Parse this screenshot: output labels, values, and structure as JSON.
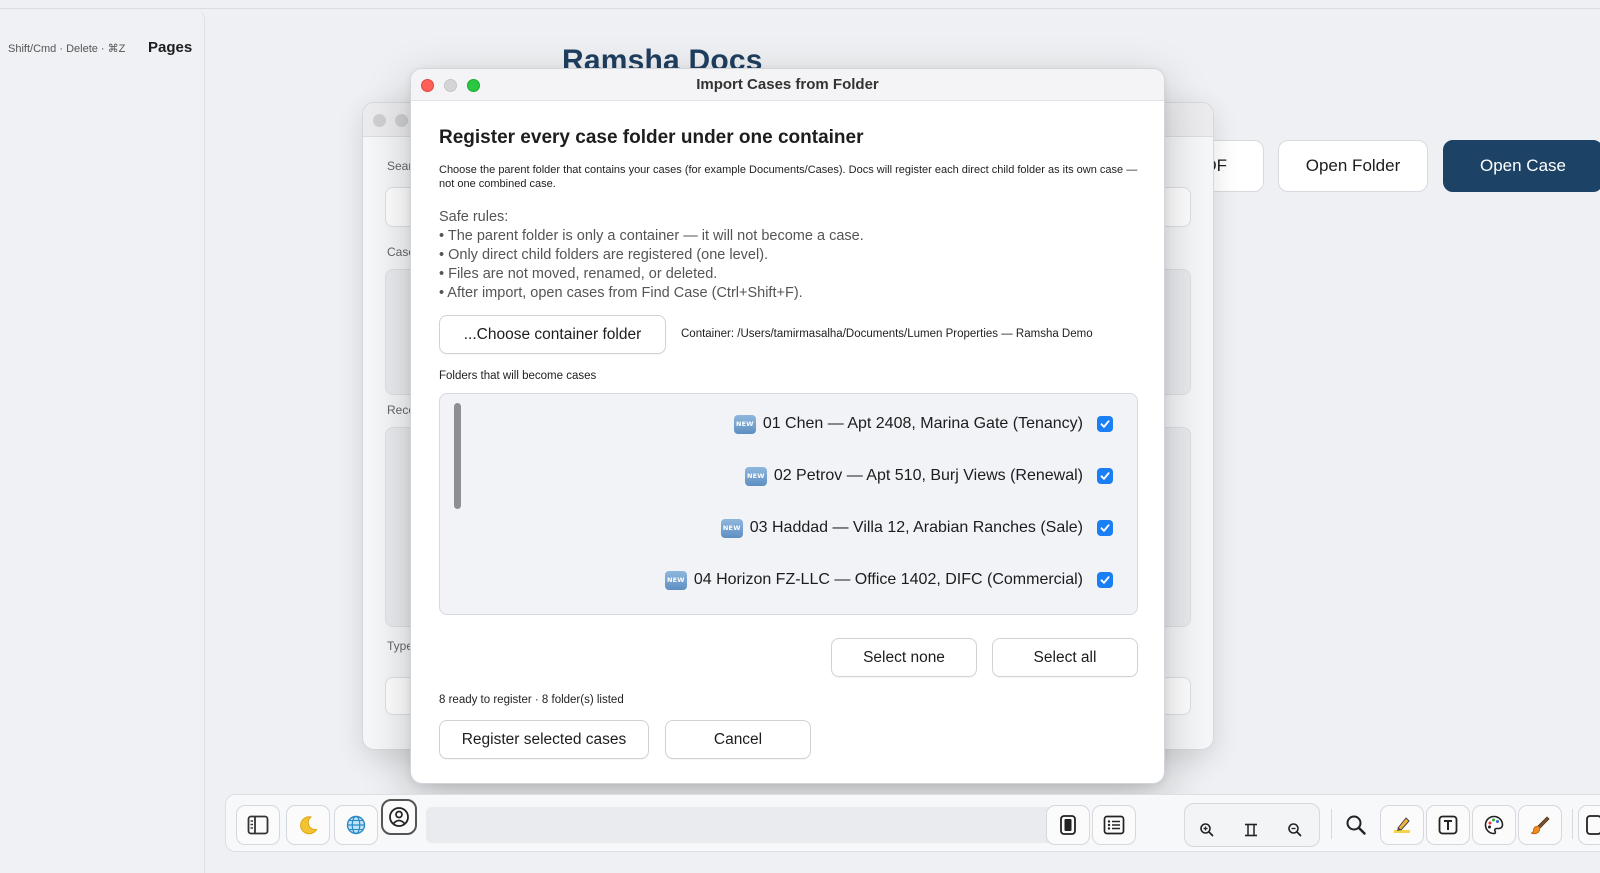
{
  "sidebar": {
    "shortcut_hint": "Shift/Cmd · Delete · ⌘Z",
    "title": "Pages"
  },
  "app": {
    "title": "Ramsha Docs",
    "header_buttons": {
      "pdf_partial": "DF",
      "open_folder": "Open Folder",
      "open_case": "Open Case"
    },
    "accent_color": "#1c4266"
  },
  "background_window": {
    "labels": [
      "Sear",
      "Case",
      "Rece",
      "Type"
    ]
  },
  "dialog": {
    "title": "Import Cases from Folder",
    "heading": "Register every case folder under one container",
    "description": "Choose the parent folder that contains your cases (for example Documents/Cases). Docs will register each direct child folder as its own case — not one combined case.",
    "rules": [
      "Safe rules:",
      "• The parent folder is only a container — it will not become a case.",
      "• Only direct child folders are registered (one level).",
      "• Files are not moved, renamed, or deleted.",
      "• After import, open cases from Find Case (Ctrl+Shift+F)."
    ],
    "choose_button": "...Choose container folder",
    "container_path": "Container: /Users/tamirmasalha/Documents/Lumen Properties — Ramsha Demo",
    "folders_label": "Folders that will become cases",
    "new_badge": "NEW",
    "folders": [
      {
        "name": "01 Chen — Apt 2408, Marina Gate (Tenancy)",
        "checked": true
      },
      {
        "name": "02 Petrov — Apt 510, Burj Views (Renewal)",
        "checked": true
      },
      {
        "name": "03 Haddad — Villa 12, Arabian Ranches (Sale)",
        "checked": true
      },
      {
        "name": "04 Horizon FZ-LLC — Office 1402, DIFC (Commercial)",
        "checked": true
      }
    ],
    "select_none": "Select none",
    "select_all": "Select all",
    "status": "8 ready to register · 8 folder(s) listed",
    "register_button": "Register selected cases",
    "cancel_button": "Cancel",
    "checkbox_color": "#1a7ef5"
  },
  "toolbar": {
    "icons": [
      "sidebar-icon",
      "moon-icon",
      "globe-icon",
      "user-circle-icon",
      "page-icon",
      "list-icon",
      "zoom-in-icon",
      "fit-icon",
      "zoom-out-icon",
      "search-icon",
      "highlighter-icon",
      "text-box-icon",
      "palette-icon",
      "brush-icon"
    ]
  }
}
